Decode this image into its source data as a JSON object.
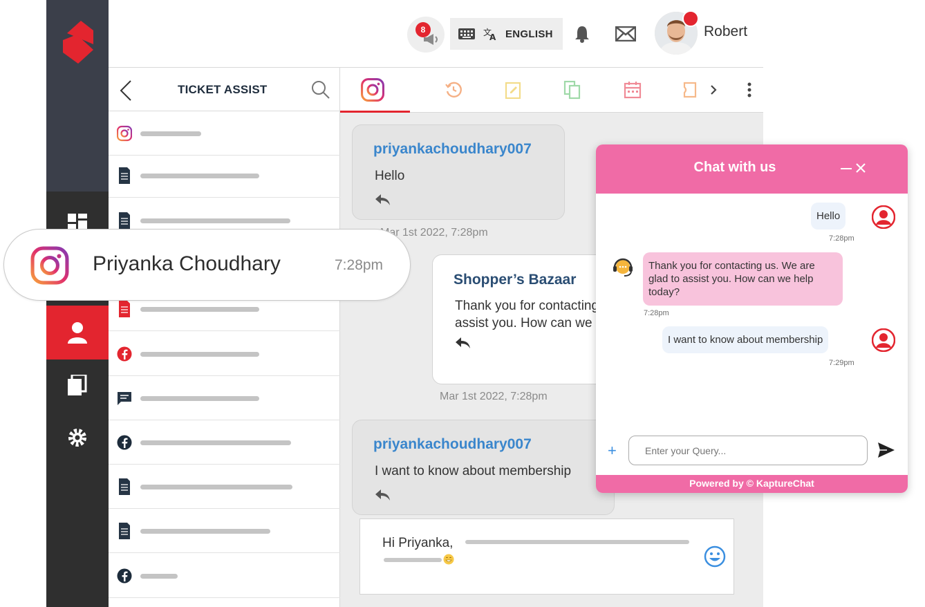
{
  "header": {
    "notification_count": "8",
    "language": "ENGLISH",
    "user_name": "Robert"
  },
  "ticket_panel": {
    "title": "TICKET ASSIST",
    "rows": [
      {
        "icon": "instagram-icon"
      },
      {
        "icon": "document-icon"
      },
      {
        "icon": "document-icon"
      },
      {
        "icon": "document-icon"
      },
      {
        "icon": "document-icon"
      },
      {
        "icon": "facebook-icon"
      },
      {
        "icon": "chat-icon"
      },
      {
        "icon": "facebook-icon"
      },
      {
        "icon": "document-icon"
      },
      {
        "icon": "document-icon"
      },
      {
        "icon": "facebook-icon"
      }
    ]
  },
  "conversation": {
    "messages": [
      {
        "sender": "priyankachoudhary007",
        "text": "Hello",
        "time": "Mar 1st 2022, 7:28pm"
      },
      {
        "sender": "Shopper’s Bazaar",
        "text_line1": "Thank you for contacting us. We are glad to",
        "text_line2": "assist you. How can we help today?",
        "time": "Mar 1st 2022, 7:28pm"
      },
      {
        "sender": "priyankachoudhary007",
        "text": "I want to know about membership"
      }
    ],
    "composer": {
      "text": "Hi Priyanka,"
    }
  },
  "pill": {
    "name": "Priyanka Choudhary",
    "time": "7:28pm"
  },
  "widget": {
    "title": "Chat with us",
    "messages": [
      {
        "from": "user",
        "text": "Hello",
        "time": "7:28pm"
      },
      {
        "from": "agent",
        "text": "Thank you for contacting us. We are glad to assist you. How can we help today?",
        "time": "7:28pm"
      },
      {
        "from": "user",
        "text": "I want to know about membership",
        "time": "7:29pm"
      }
    ],
    "input_placeholder": "Enter your Query...",
    "footer": "Powered by © KaptureChat"
  },
  "colors": {
    "brand_red": "#e3252f",
    "widget_pink": "#f06ba6",
    "name_blue": "#3a86cc",
    "brand_navy": "#2a4d73"
  }
}
